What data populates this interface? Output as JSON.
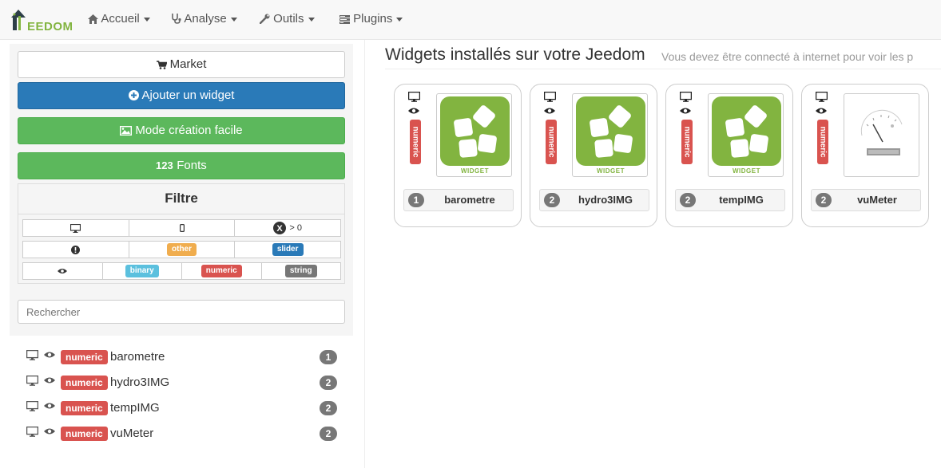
{
  "navbar": {
    "brand": "EEDOM",
    "menus": [
      {
        "label": "Accueil",
        "icon": "home-icon"
      },
      {
        "label": "Analyse",
        "icon": "stethoscope-icon"
      },
      {
        "label": "Outils",
        "icon": "wrench-icon"
      },
      {
        "label": "Plugins",
        "icon": "tasks-icon"
      }
    ]
  },
  "sidebar": {
    "buttons": {
      "market": "Market",
      "add_widget": "Ajouter un widget",
      "easy_mode": "Mode création facile",
      "fonts": "Fonts"
    },
    "filter": {
      "title": "Filtre",
      "x_label": "> 0",
      "tags": {
        "other": "other",
        "slider": "slider",
        "binary": "binary",
        "numeric": "numeric",
        "string": "string"
      }
    },
    "search_placeholder": "Rechercher",
    "list": [
      {
        "type": "numeric",
        "name": "barometre",
        "count": "1"
      },
      {
        "type": "numeric",
        "name": "hydro3IMG",
        "count": "2"
      },
      {
        "type": "numeric",
        "name": "tempIMG",
        "count": "2"
      },
      {
        "type": "numeric",
        "name": "vuMeter",
        "count": "2"
      }
    ]
  },
  "main": {
    "title": "Widgets installés sur votre Jeedom",
    "subtitle": "Vous devez être connecté à internet pour voir les p",
    "widget_text": "WIDGET",
    "cards": [
      {
        "type": "numeric",
        "name": "barometre",
        "count": "1",
        "thumb": "widget-logo"
      },
      {
        "type": "numeric",
        "name": "hydro3IMG",
        "count": "2",
        "thumb": "widget-logo"
      },
      {
        "type": "numeric",
        "name": "tempIMG",
        "count": "2",
        "thumb": "widget-logo"
      },
      {
        "type": "numeric",
        "name": "vuMeter",
        "count": "2",
        "thumb": "vu-meter-gauge"
      }
    ]
  },
  "colors": {
    "primary": "#2a7ab8",
    "success": "#5cb85c",
    "danger": "#d9534f",
    "warning": "#f0ad4e",
    "info": "#5bc0de",
    "default": "#777777",
    "brand": "#82b440"
  }
}
